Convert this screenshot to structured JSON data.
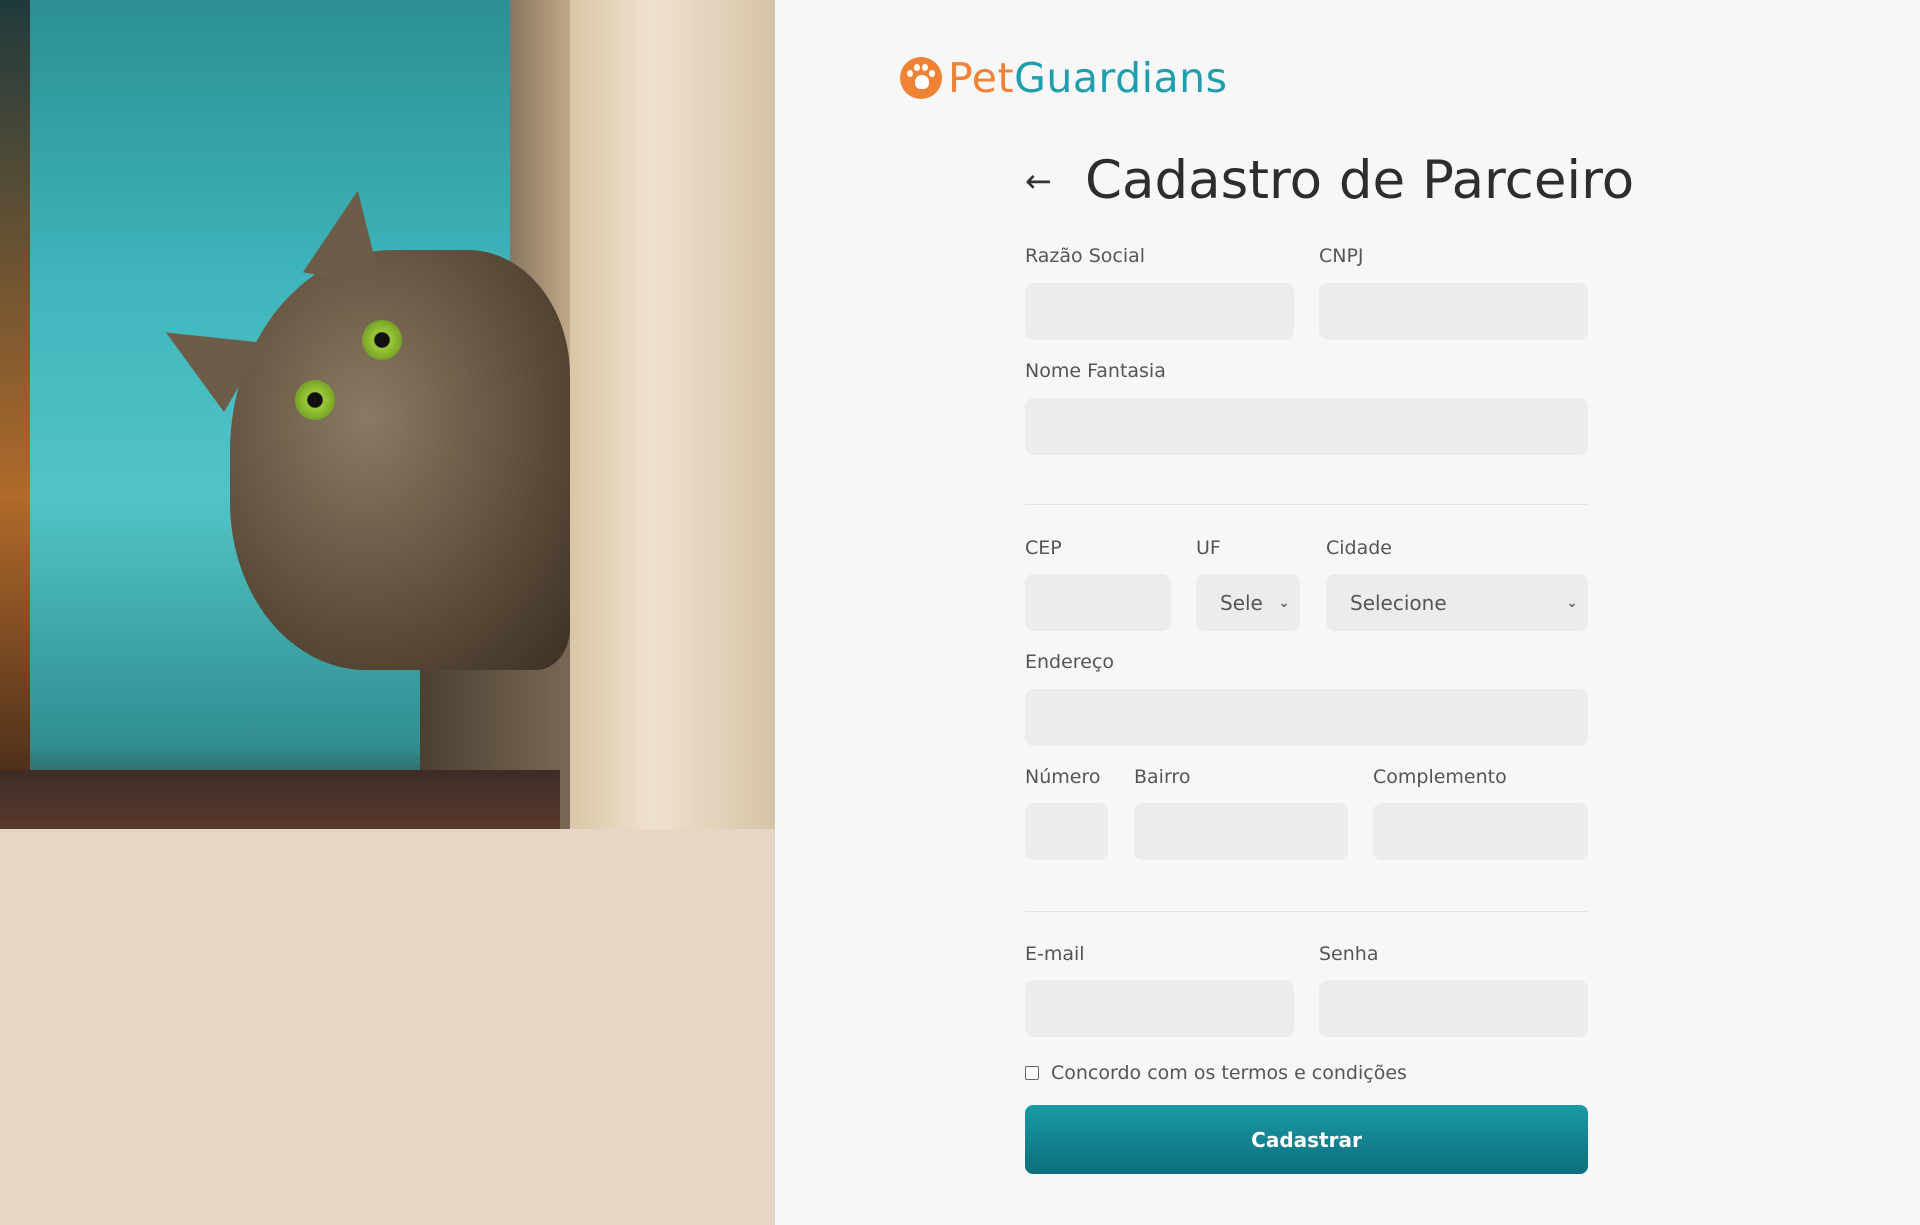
{
  "brand": {
    "part1": "Pet",
    "part2": "Guardians",
    "colors": {
      "orange": "#f08236",
      "teal": "#1f9fad"
    }
  },
  "page": {
    "title": "Cadastro de Parceiro",
    "back_icon": "arrow-left-icon"
  },
  "form": {
    "razao_social": {
      "label": "Razão Social",
      "value": ""
    },
    "cnpj": {
      "label": "CNPJ",
      "value": ""
    },
    "nome_fantasia": {
      "label": "Nome Fantasia",
      "value": ""
    },
    "cep": {
      "label": "CEP",
      "value": ""
    },
    "uf": {
      "label": "UF",
      "selected": "Sele"
    },
    "cidade": {
      "label": "Cidade",
      "selected": "Selecione"
    },
    "endereco": {
      "label": "Endereço",
      "value": ""
    },
    "numero": {
      "label": "Número",
      "value": ""
    },
    "bairro": {
      "label": "Bairro",
      "value": ""
    },
    "complemento": {
      "label": "Complemento",
      "value": ""
    },
    "email": {
      "label": "E-mail",
      "value": ""
    },
    "senha": {
      "label": "Senha",
      "value": ""
    },
    "terms": {
      "label": "Concordo com os termos e condições",
      "checked": false
    },
    "submit": "Cadastrar"
  }
}
